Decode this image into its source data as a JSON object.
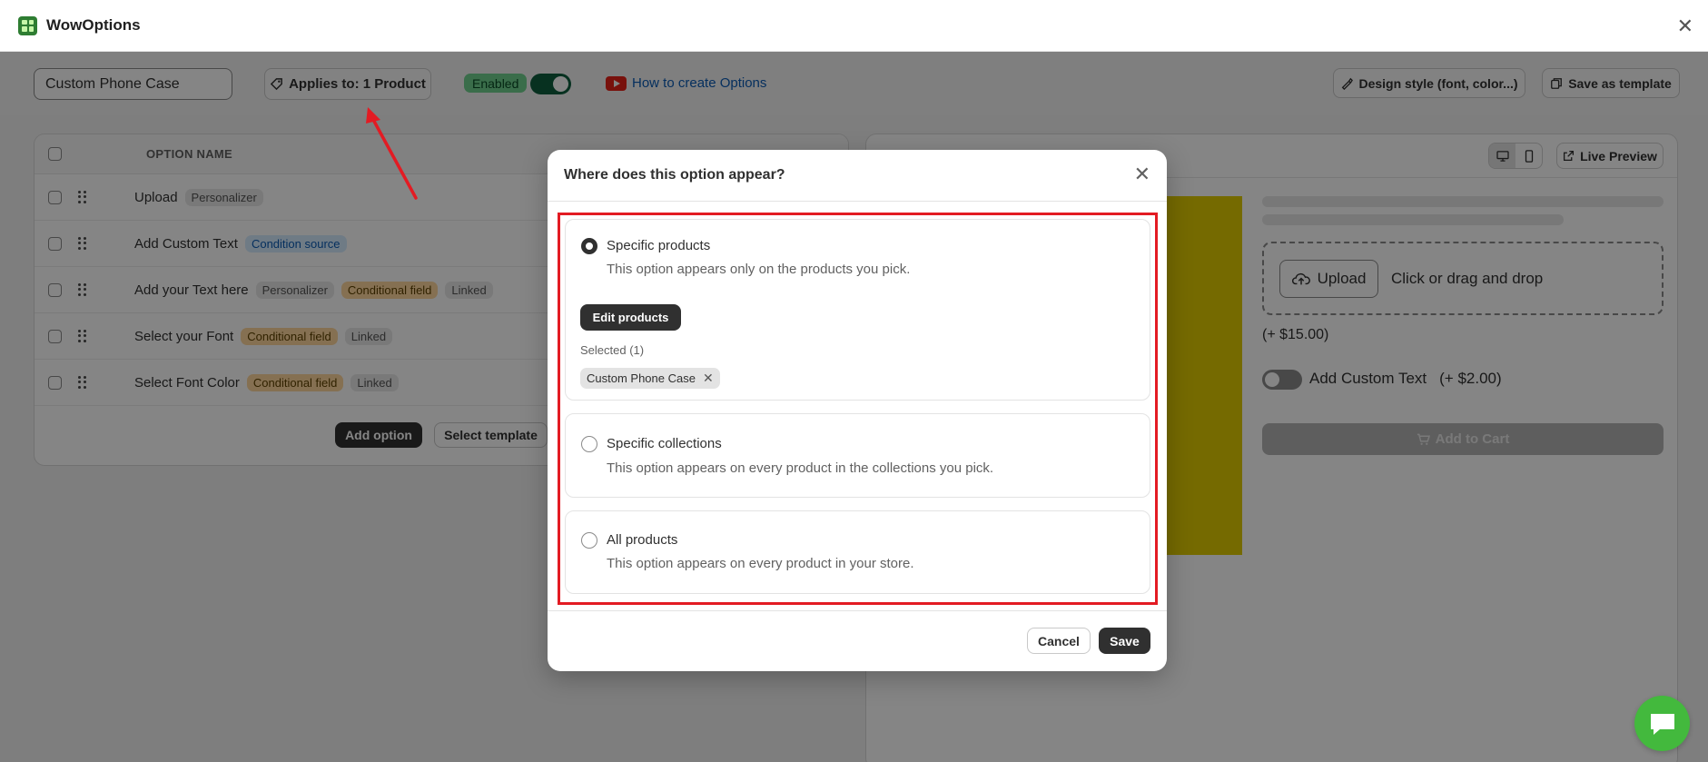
{
  "app": {
    "title": "WowOptions",
    "close_icon": "close-icon"
  },
  "toolbar": {
    "option_set_name": "Custom Phone Case",
    "applies_to": "Applies to: 1 Product",
    "enabled_label": "Enabled",
    "enabled": true,
    "how_to_link": "How to create Options",
    "design_style": "Design style (font, color...)",
    "save_as_template": "Save as template"
  },
  "options_table": {
    "header_name": "OPTION NAME",
    "rows": [
      {
        "name": "Upload",
        "badges": [
          {
            "text": "Personalizer",
            "kind": "gray"
          }
        ]
      },
      {
        "name": "Add Custom Text",
        "badges": [
          {
            "text": "Condition source",
            "kind": "blue"
          }
        ]
      },
      {
        "name": "Add your Text here",
        "badges": [
          {
            "text": "Personalizer",
            "kind": "gray"
          },
          {
            "text": "Conditional field",
            "kind": "orange"
          },
          {
            "text": "Linked",
            "kind": "gray"
          }
        ]
      },
      {
        "name": "Select your Font",
        "badges": [
          {
            "text": "Conditional field",
            "kind": "orange"
          },
          {
            "text": "Linked",
            "kind": "gray"
          }
        ]
      },
      {
        "name": "Select Font Color",
        "badges": [
          {
            "text": "Conditional field",
            "kind": "orange"
          },
          {
            "text": "Linked",
            "kind": "gray"
          }
        ]
      }
    ],
    "add_option": "Add option",
    "select_template": "Select template"
  },
  "preview": {
    "live_preview": "Live Preview",
    "upload_button": "Upload",
    "upload_hint": "Click or drag and drop",
    "upload_price": "(+ $15.00)",
    "custom_text_label": "Add Custom Text",
    "custom_text_price": "(+ $2.00)",
    "add_to_cart": "Add to Cart",
    "product_color": "#e1cb00"
  },
  "modal": {
    "title": "Where does this option appear?",
    "choices": [
      {
        "title": "Specific products",
        "desc": "This option appears only on the products you pick.",
        "checked": true
      },
      {
        "title": "Specific collections",
        "desc": "This option appears on every product in the collections you pick.",
        "checked": false
      },
      {
        "title": "All products",
        "desc": "This option appears on every product in your store.",
        "checked": false
      }
    ],
    "edit_products": "Edit products",
    "selected_label": "Selected (1)",
    "selected_product": "Custom Phone Case",
    "cancel": "Cancel",
    "save": "Save"
  },
  "colors": {
    "accent_dark": "#303030",
    "toggle_on": "#0e5e3e",
    "highlight_red": "#e31b23",
    "chat_green": "#43b93d"
  }
}
